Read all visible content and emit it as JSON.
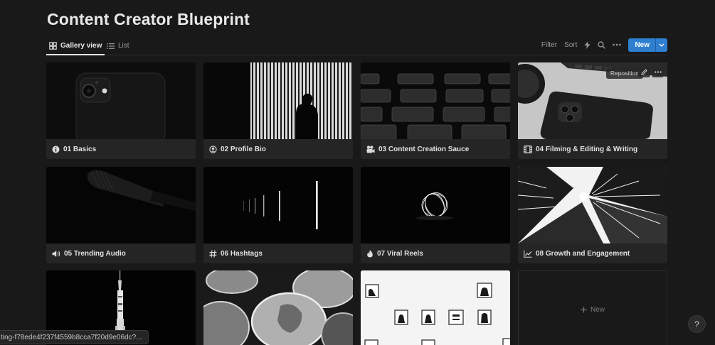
{
  "page": {
    "title": "Content Creator Blueprint"
  },
  "views": {
    "gallery": {
      "label": "Gallery view",
      "icon": "gallery-grid-icon"
    },
    "list": {
      "label": "List",
      "icon": "list-icon"
    }
  },
  "toolbar": {
    "filter": "Filter",
    "sort": "Sort",
    "automation_icon": "lightning-icon",
    "search_icon": "search-icon",
    "more_icon": "more-dots-icon",
    "new_label": "New"
  },
  "cards": [
    {
      "title": "01 Basics",
      "icon": "info-circle-icon",
      "cover": "black iphone camera"
    },
    {
      "title": "02  Profile Bio",
      "icon": "person-circle-icon",
      "cover": "silhouette against blinds"
    },
    {
      "title": "03 Content Creation Sauce",
      "icon": "film-camera-icon",
      "cover": "rows of cinema seats"
    },
    {
      "title": "04 Filming & Editing & Writing",
      "icon": "film-frame-icon",
      "cover": "iphone on desk",
      "reposition": "Reposition"
    },
    {
      "title": "05 Trending Audio",
      "icon": "speaker-icon",
      "cover": "microphone"
    },
    {
      "title": "06 Hashtags",
      "icon": "hashtag-icon",
      "cover": "light lines"
    },
    {
      "title": "07 Viral Reels",
      "icon": "fire-icon",
      "cover": "light orb"
    },
    {
      "title": "08 Growth and Engagement",
      "icon": "chart-line-icon",
      "cover": "buildings looking up"
    },
    {
      "title": "",
      "icon": "",
      "cover": "rocket"
    },
    {
      "title": "",
      "icon": "",
      "cover": "coins"
    },
    {
      "title": "",
      "icon": "",
      "cover": "frames on wall"
    }
  ],
  "new_card_label": "New",
  "status_url": "ting-f78ede4f237f4559b8cca7f20d9e06dc?...",
  "help_label": "?",
  "colors": {
    "background": "#191919",
    "card": "#252525",
    "accent": "#2f7fd1"
  }
}
